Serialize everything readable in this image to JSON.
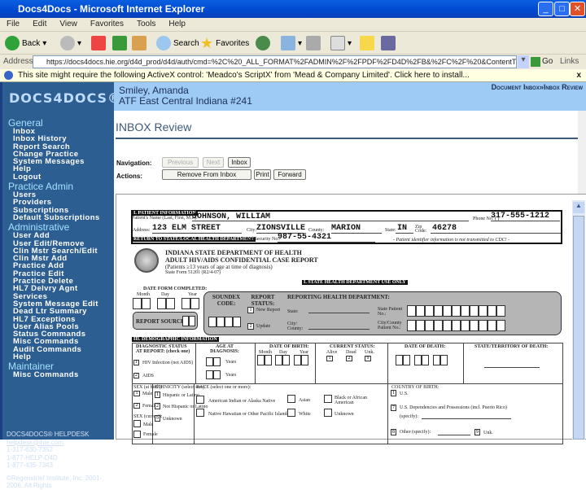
{
  "window": {
    "title": "Docs4Docs - Microsoft Internet Explorer"
  },
  "menu": [
    "File",
    "Edit",
    "View",
    "Favorites",
    "Tools",
    "Help"
  ],
  "toolbar": {
    "back": "Back",
    "search": "Search",
    "favorites": "Favorites"
  },
  "address": {
    "label": "Address",
    "url": "https://docs4docs.hie.org/d4d_prod/d4d/auth/cmd=%2C%20_ALL_FORMAT%2FADMIN%2F%2FPDF%2FD4D%2FB&%2FC%2F%20&ContentType=pdf",
    "go": "Go",
    "links": "Links"
  },
  "infobar": {
    "text": "This site might require the following ActiveX control: 'Meadco's ScriptX' from 'Mead & Company Limited'. Click here to install...",
    "close": "x"
  },
  "sidebar": {
    "logo": "DOCS4DOCS®",
    "sections": [
      {
        "title": "General",
        "items": [
          "Inbox",
          "Inbox History",
          "Report Search",
          "Change Practice",
          "System Messages",
          "Help",
          "Logout"
        ]
      },
      {
        "title": "Practice Admin",
        "items": [
          "Users",
          "Providers",
          "Subscriptions",
          "Default Subscriptions"
        ]
      },
      {
        "title": "Administrative",
        "items": [
          "User Add",
          "User Edit/Remove",
          "Clin Mstr Search/Edit",
          "Clin Mstr Add",
          "Practice Add",
          "Practice Edit",
          "Practice Delete",
          "HL7 Delvry Agnt",
          "Services",
          "System Message Edit",
          "Dead Ltr Summary",
          "HL7 Exceptions",
          "User Alias Pools",
          "Status Commands",
          "Misc Commands",
          "Audit Commands",
          "Help"
        ]
      },
      {
        "title": "Maintainer",
        "items": [
          "Misc Commands"
        ]
      }
    ],
    "footer": {
      "brand": "DOCS4DOCS® HELPDESK",
      "email": "helpdesk@ihie.com",
      "phones": [
        "1-317-630-7352",
        "1-877-HELP-D4D",
        "1-877-435-7343"
      ],
      "copyright": "©Regenstrief Institute, Inc. 2001-2006. All Rights"
    }
  },
  "header": {
    "user": "Smiley, Amanda",
    "practice": "ATF East Central Indiana #241",
    "breadcrumb": "Document Inbox»Inbox Review"
  },
  "page": {
    "title": "INBOX Review",
    "nav_label": "Navigation:",
    "previous": "Previous",
    "next": "Next",
    "inbox": "Inbox",
    "actions_label": "Actions:",
    "remove": "Remove From Inbox",
    "print": "Print",
    "forward": "Forward"
  },
  "form": {
    "patient_header": "I. PATIENT INFORMATION",
    "name_label": "Patient's Name (Last, First, M.I.):",
    "name": "JOHNSON, WILLIAM",
    "phone_label": "Phone No. (     )",
    "phone": "317-555-1212",
    "address_label": "Address:",
    "address": "123 ELM STREET",
    "city_label": "City:",
    "city": "ZIONSVILLE",
    "county_label": "County:",
    "county": "MARION",
    "state_label": "State:",
    "state": "IN",
    "zip_label": "Zip Code:",
    "zip": "46278",
    "return_label": "RETURN TO STATE/LOCAL HEALTH DEPARTMENT",
    "ssn_label": "Social Security No.:",
    "ssn": "987-55-4321",
    "cdc_note": "- Patient identifier information is not transmitted to CDC! -",
    "agency": "INDIANA STATE DEPARTMENT OF HEALTH",
    "report_title": "ADULT HIV/AIDS CONFIDENTIAL CASE REPORT",
    "subtitle": "(Patients ≥13 years of age at time of diagnosis)",
    "state_form": "State Form 51201 (R2/4-07)",
    "state_use": "I. STATE HEALTH DEPARTMENT USE ONLY",
    "date_completed": "DATE FORM COMPLETED:",
    "month": "Month",
    "day": "Day",
    "year": "Year",
    "report_source": "REPORT SOURCE:",
    "soundex": "SOUNDEX CODE:",
    "report_status": "REPORT STATUS:",
    "new_report": "New Report",
    "update": "Update",
    "reporting_dept": "REPORTING HEALTH DEPARTMENT:",
    "state_field": "State:",
    "city_county": "City/ County:",
    "state_patient_no": "State Patient No.:",
    "city_patient_no": "City/County Patient No.:",
    "demo_header": "III. DEMOGRAPHIC INFORMATION",
    "diag_status": "DIAGNOSTIC STATUS AT REPORT: (check one)",
    "hiv_infection": "HIV Infection (not AIDS)",
    "aids": "AIDS",
    "age_diag": "AGE AT DIAGNOSIS:",
    "years": "Years",
    "dob": "DATE OF BIRTH:",
    "current_status": "CURRENT STATUS:",
    "alive": "Alive",
    "dead": "Dead",
    "unk": "Unk.",
    "dod": "DATE OF DEATH:",
    "state_death": "STATE/TERRITORY OF DEATH:",
    "sex": "SEX (at birth):",
    "male": "Male",
    "female": "Female",
    "sex_current": "SEX (current):",
    "ethnicity": "ETHNICITY (select one):",
    "hispanic": "Hispanic or Latino",
    "not_hispanic": "Not Hispanic or Latino",
    "unknown": "Unknown",
    "race": "RACE (select one or more):",
    "amer_indian": "American Indian or Alaska Native",
    "asian": "Asian",
    "black": "Black or African American",
    "hawaiian": "Native Hawaiian or Other Pacific Islander",
    "white": "White",
    "race_unknown": "Unknown",
    "country": "COUNTRY OF BIRTH:",
    "us": "U.S.",
    "us_dep": "U.S. Dependencies and Possessions (incl. Puerto Rico)",
    "specify": "(specify):",
    "other": "Other (specify):",
    "unk_country": "Unk."
  }
}
